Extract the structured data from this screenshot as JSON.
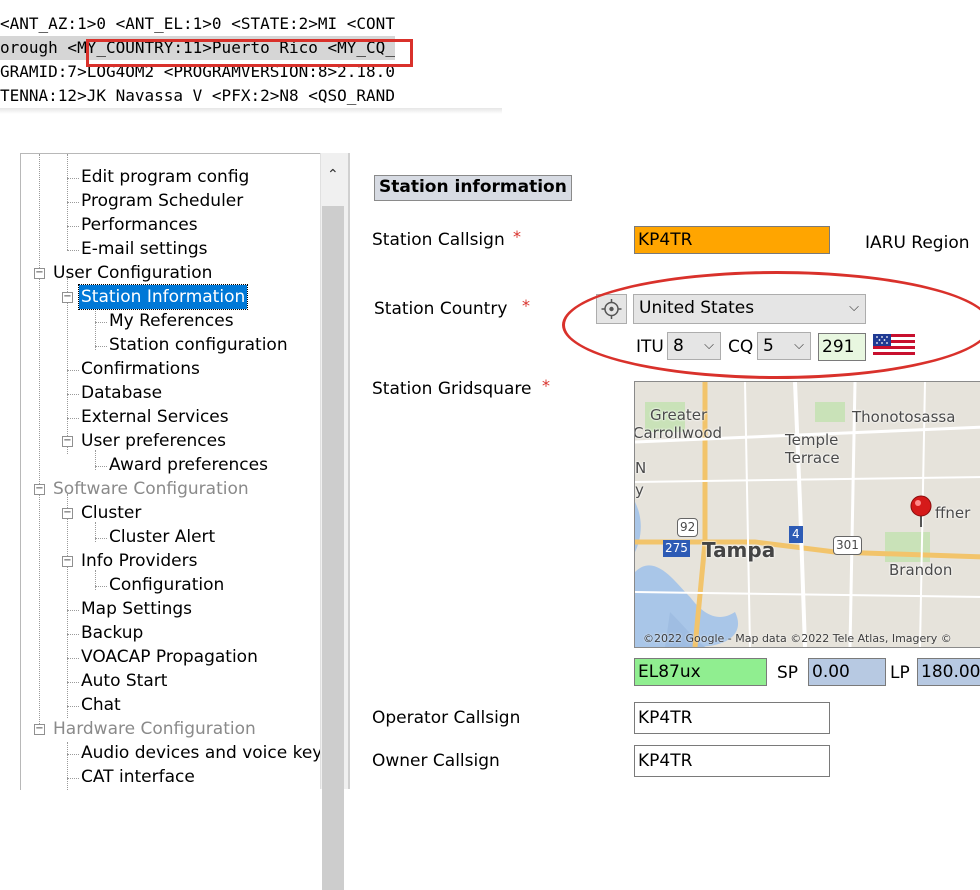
{
  "adif": {
    "lines": [
      "<ANT_AZ:1>0 <ANT_EL:1>0 <STATE:2>MI <CONT",
      "orough <MY_COUNTRY:11>Puerto Rico <MY_CQ_",
      "GRAMID:7>LOG4OM2 <PROGRAMVERSION:8>2.18.0",
      "TENNA:12>JK Navassa V <PFX:2>N8 <QSO_RAND"
    ]
  },
  "tree": {
    "items": [
      {
        "label": "Edit program config"
      },
      {
        "label": "Program Scheduler"
      },
      {
        "label": "Performances"
      },
      {
        "label": "E-mail settings"
      },
      {
        "label": "User Configuration"
      },
      {
        "label": "Station Information"
      },
      {
        "label": "My References"
      },
      {
        "label": "Station configuration"
      },
      {
        "label": "Confirmations"
      },
      {
        "label": "Database"
      },
      {
        "label": "External Services"
      },
      {
        "label": "User preferences"
      },
      {
        "label": "Award preferences"
      },
      {
        "label": "Software Configuration"
      },
      {
        "label": "Cluster"
      },
      {
        "label": "Cluster Alert"
      },
      {
        "label": "Info Providers"
      },
      {
        "label": "Configuration"
      },
      {
        "label": "Map Settings"
      },
      {
        "label": "Backup"
      },
      {
        "label": "VOACAP Propagation"
      },
      {
        "label": "Auto Start"
      },
      {
        "label": "Chat"
      },
      {
        "label": "Hardware Configuration"
      },
      {
        "label": "Audio devices and voice keye"
      },
      {
        "label": "CAT interface"
      }
    ]
  },
  "form": {
    "section_title": "Station information",
    "required_mark": "*",
    "callsign_label": "Station Callsign",
    "callsign_value": "KP4TR",
    "iaru_label": "IARU Region",
    "country_label": "Station Country",
    "country_value": "United States",
    "itu_label": "ITU",
    "itu_value": "8",
    "cq_label": "CQ",
    "cq_value": "5",
    "dxcc_value": "291",
    "gridsquare_label": "Station Gridsquare",
    "gridsquare_value": "EL87ux",
    "sp_label": "SP",
    "sp_value": "0.00",
    "lp_label": "LP",
    "lp_value": "180.00",
    "operator_label": "Operator Callsign",
    "operator_value": "KP4TR",
    "owner_label": "Owner Callsign",
    "owner_value": "KP4TR",
    "colors": {
      "callsign_bg": "#ffa500",
      "grid_bg": "#90ee90",
      "dxcc_bg": "#e8f7e0",
      "sp_lp_bg": "#b7c9e2"
    }
  },
  "map": {
    "labels": [
      "Greater",
      "Carrollwood",
      "Temple",
      "Terrace",
      "Thonotosassa",
      "Tampa",
      "Brandon",
      "ffner",
      "N",
      "y"
    ],
    "shields": [
      "92",
      "275",
      "4",
      "301"
    ],
    "copyright": "©2022 Google - Map data ©2022 Tele Atlas, Imagery ©"
  }
}
